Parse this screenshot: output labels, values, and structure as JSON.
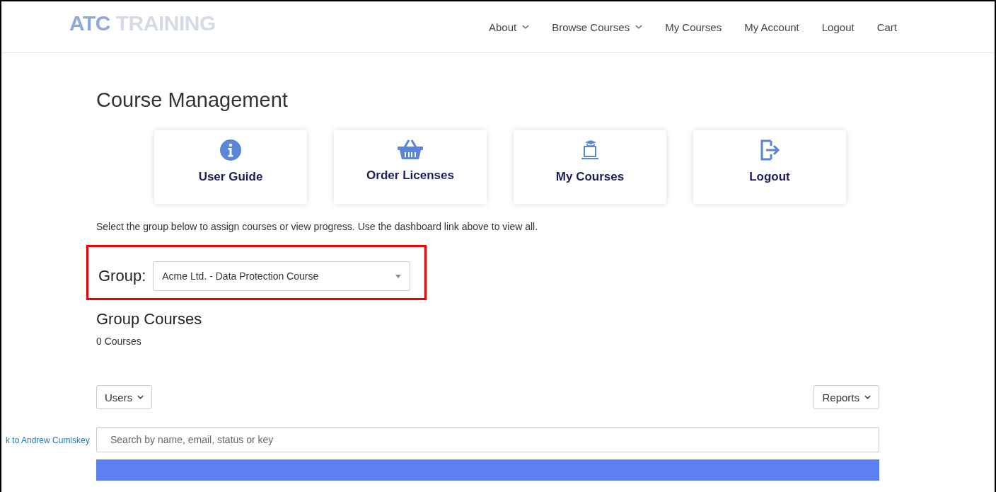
{
  "header": {
    "logo": {
      "part_1": "ATC",
      "part_2": "TRAINING"
    },
    "nav": [
      {
        "label": "About",
        "has_menu": true
      },
      {
        "label": "Browse Courses",
        "has_menu": true
      },
      {
        "label": "My Courses",
        "has_menu": false
      },
      {
        "label": "My Account",
        "has_menu": false
      },
      {
        "label": "Logout",
        "has_menu": false
      },
      {
        "label": "Cart",
        "has_menu": false
      }
    ]
  },
  "page_title": "Course Management",
  "cards": [
    {
      "label": "User Guide",
      "kind": "info"
    },
    {
      "label": "Order Licenses",
      "kind": "basket"
    },
    {
      "label": "My Courses",
      "kind": "course"
    },
    {
      "label": "Logout",
      "kind": "logout"
    }
  ],
  "intro": "Select the group below to assign courses or view progress. Use the dashboard link above to view all.",
  "group": {
    "label": "Group:",
    "value": "Acme Ltd. - Data Protection Course",
    "highlighted": true
  },
  "group_courses": {
    "title": "Group Courses",
    "count": "0 Courses"
  },
  "users_button": "Users",
  "reports_button": "Reports",
  "search": {
    "placeholder": "Search by name, email, status or key"
  },
  "side_link": "k to Andrew Cumiskey"
}
